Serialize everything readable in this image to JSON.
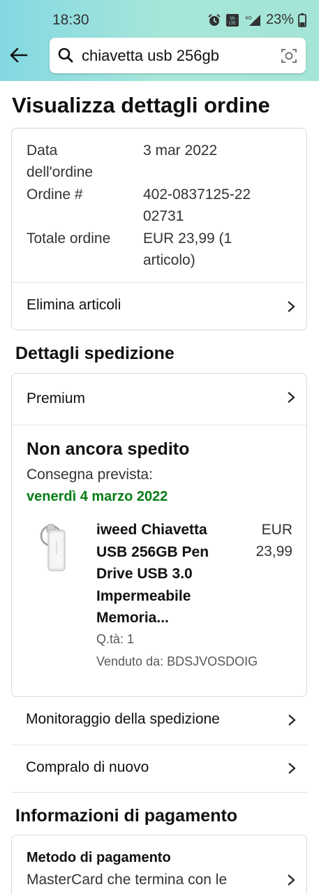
{
  "status_bar": {
    "time": "18:30",
    "battery": "23%"
  },
  "search": {
    "query": "chiavetta usb 256gb"
  },
  "page": {
    "title": "Visualizza dettagli ordine"
  },
  "order_summary": {
    "date_label": "Data dell'ordine",
    "date_value": "3 mar 2022",
    "order_label": "Ordine #",
    "order_value": "402-0837125-2202731",
    "total_label": "Totale ordine",
    "total_value": "EUR 23,99 (1 articolo)",
    "delete_items": "Elimina articoli"
  },
  "shipping": {
    "section_title": "Dettagli spedizione",
    "method": "Premium",
    "status": "Non ancora spedito",
    "delivery_label": "Consegna prevista:",
    "delivery_date": "venerdì 4 marzo 2022",
    "product": {
      "name": "iweed Chiavetta USB 256GB Pen Drive USB 3.0 Impermeabile Memoria...",
      "price": "EUR 23,99",
      "quantity": "Q.tà: 1",
      "seller": "Venduto da: BDSJVOSDOIG"
    },
    "track": "Monitoraggio della spedizione",
    "buy_again": "Compralo di nuovo"
  },
  "payment": {
    "section_title": "Informazioni di pagamento",
    "method_title": "Metodo di pagamento",
    "method_desc": "MasterCard che termina con le"
  },
  "colors": {
    "delivery_green": "#067d14",
    "header_teal": "#84d8e3"
  },
  "icons": [
    "back-arrow-icon",
    "search-icon",
    "camera-lens-icon",
    "chevron-right-icon",
    "alarm-icon",
    "signal-icon",
    "battery-icon"
  ]
}
